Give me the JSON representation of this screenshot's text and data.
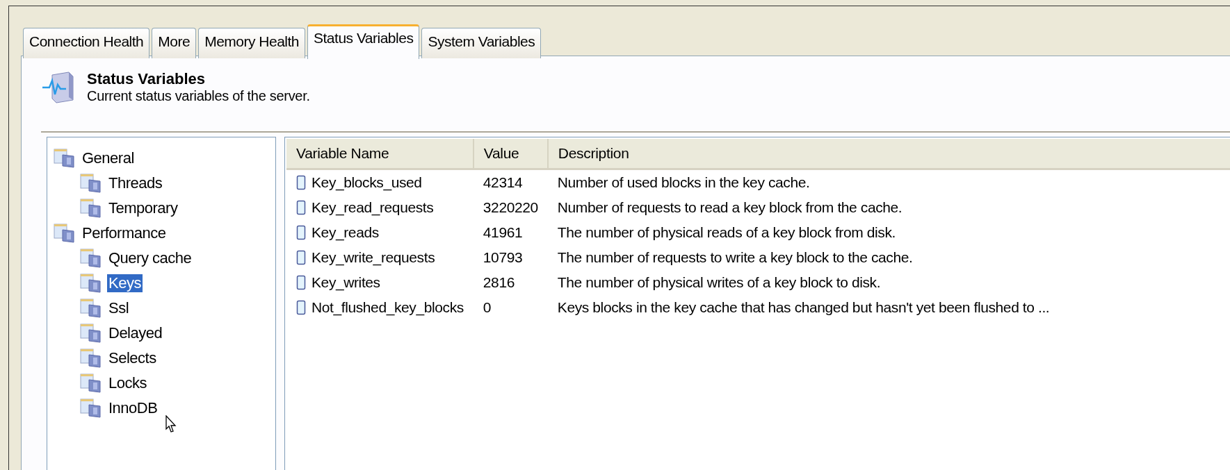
{
  "tabs": [
    {
      "label": "Connection Health",
      "selected": false
    },
    {
      "label": "More",
      "selected": false
    },
    {
      "label": "Memory Health",
      "selected": false
    },
    {
      "label": "Status Variables",
      "selected": true
    },
    {
      "label": "System Variables",
      "selected": false
    }
  ],
  "header": {
    "title": "Status Variables",
    "subtitle": "Current status variables of the server."
  },
  "tree": [
    {
      "label": "General",
      "selected": false,
      "children": [
        {
          "label": "Threads",
          "selected": false
        },
        {
          "label": "Temporary",
          "selected": false
        }
      ]
    },
    {
      "label": "Performance",
      "selected": false,
      "children": [
        {
          "label": "Query cache",
          "selected": false
        },
        {
          "label": "Keys",
          "selected": true
        },
        {
          "label": "Ssl",
          "selected": false
        },
        {
          "label": "Delayed",
          "selected": false
        },
        {
          "label": "Selects",
          "selected": false
        },
        {
          "label": "Locks",
          "selected": false
        },
        {
          "label": "InnoDB",
          "selected": false
        }
      ]
    }
  ],
  "table": {
    "columns": [
      "Variable Name",
      "Value",
      "Description"
    ],
    "rows": [
      [
        "Key_blocks_used",
        "42314",
        "Number of used blocks in the key cache."
      ],
      [
        "Key_read_requests",
        "3220220",
        "Number of requests to read a key block from the cache."
      ],
      [
        "Key_reads",
        "41961",
        "The number of physical reads of a key block from disk."
      ],
      [
        "Key_write_requests",
        "10793",
        "The number of requests to write a key block to the cache."
      ],
      [
        "Key_writes",
        "2816",
        "The number of physical writes of a key block to disk."
      ],
      [
        "Not_flushed_key_blocks",
        "0",
        "Keys blocks in the key cache that has changed but hasn't yet been flushed to ..."
      ]
    ]
  }
}
